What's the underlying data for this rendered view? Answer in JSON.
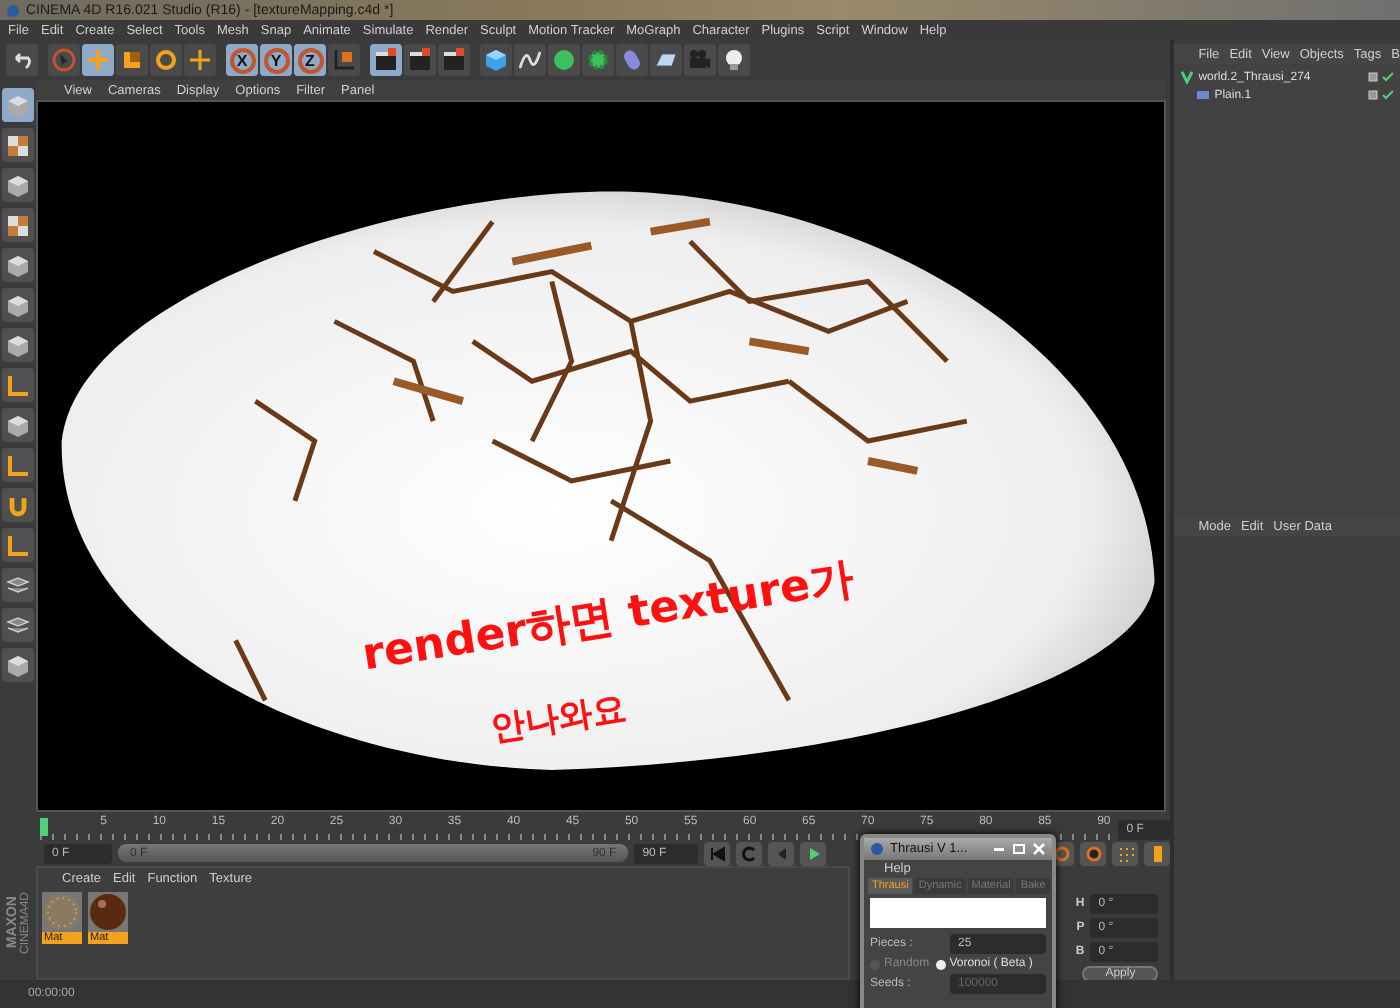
{
  "window": {
    "title": "CINEMA 4D R16.021 Studio (R16) - [textureMapping.c4d *]"
  },
  "menu": [
    "File",
    "Edit",
    "Create",
    "Select",
    "Tools",
    "Mesh",
    "Snap",
    "Animate",
    "Simulate",
    "Render",
    "Sculpt",
    "Motion Tracker",
    "MoGraph",
    "Character",
    "Plugins",
    "Script",
    "Window",
    "Help"
  ],
  "toolbar": [
    {
      "kind": "undo",
      "active": false
    },
    {
      "kind": "select",
      "active": false
    },
    {
      "kind": "move",
      "active": true
    },
    {
      "kind": "scale",
      "active": false
    },
    {
      "kind": "rotate",
      "active": false
    },
    {
      "kind": "crosshair",
      "active": false
    },
    {
      "kind": "axis",
      "label": "X",
      "active": true
    },
    {
      "kind": "axis",
      "label": "Y",
      "active": true
    },
    {
      "kind": "axis",
      "label": "Z",
      "active": true
    },
    {
      "kind": "coord",
      "active": false
    },
    {
      "kind": "clapper",
      "active": true
    },
    {
      "kind": "clapper",
      "active": false
    },
    {
      "kind": "clapper",
      "active": false
    },
    {
      "kind": "cube",
      "active": false
    },
    {
      "kind": "spline",
      "active": false
    },
    {
      "kind": "sphere",
      "active": false
    },
    {
      "kind": "gear",
      "active": false
    },
    {
      "kind": "capsule",
      "active": false
    },
    {
      "kind": "plane",
      "active": false
    },
    {
      "kind": "camera",
      "active": false
    },
    {
      "kind": "bulb",
      "active": false
    }
  ],
  "left_toolbar": [
    {
      "kind": "cube",
      "active": true
    },
    {
      "kind": "checker",
      "active": false
    },
    {
      "kind": "cube",
      "active": false
    },
    {
      "kind": "checker",
      "active": false
    },
    {
      "kind": "cube",
      "active": false
    },
    {
      "kind": "cube",
      "active": false
    },
    {
      "kind": "cube",
      "active": false
    },
    {
      "kind": "orange",
      "active": false
    },
    {
      "kind": "cube",
      "active": false
    },
    {
      "kind": "orange",
      "active": false
    },
    {
      "kind": "magnet",
      "active": false
    },
    {
      "kind": "orange",
      "active": false
    },
    {
      "kind": "layers",
      "active": false
    },
    {
      "kind": "layers",
      "active": false
    },
    {
      "kind": "cube",
      "active": false
    }
  ],
  "viewport": {
    "menu": [
      "View",
      "Cameras",
      "Display",
      "Options",
      "Filter",
      "Panel"
    ],
    "annotation": [
      "render하면 texture가",
      "안나와요"
    ]
  },
  "timeline": {
    "ticks": [
      "5",
      "10",
      "15",
      "20",
      "25",
      "30",
      "35",
      "40",
      "45",
      "50",
      "55",
      "60",
      "65",
      "70",
      "75",
      "80",
      "85",
      "90"
    ],
    "frame_field": "0 F"
  },
  "playback": {
    "start_field": "0 F",
    "range": {
      "start": "0 F",
      "end": "90 F",
      "level": 1
    },
    "end_field": "90 F"
  },
  "materials": {
    "menu": [
      "Create",
      "Edit",
      "Function",
      "Texture"
    ],
    "items": [
      {
        "name": "Mat",
        "kind": "rough"
      },
      {
        "name": "Mat",
        "kind": "glossy"
      }
    ]
  },
  "logo": [
    "MAXON",
    "CINEMA4D"
  ],
  "objects": {
    "menu": [
      "File",
      "Edit",
      "View",
      "Objects",
      "Tags",
      "B"
    ],
    "rows": [
      {
        "name": "world.2_Thrausi_274",
        "kind": "generator",
        "children": [
          {
            "name": "Plain.1",
            "kind": "plane"
          }
        ]
      }
    ]
  },
  "attributes": {
    "menu": [
      "Mode",
      "Edit",
      "User Data"
    ]
  },
  "coordinates": {
    "rows": [
      {
        "axis": "H",
        "value": "0 °"
      },
      {
        "axis": "P",
        "value": "0 °"
      },
      {
        "axis": "B",
        "value": "0 °"
      }
    ],
    "apply": "Apply"
  },
  "dialog": {
    "title": "Thrausi V 1...",
    "menu": [
      "Help"
    ],
    "tabs": [
      {
        "label": "Thrausi",
        "selected": true
      },
      {
        "label": "Dynamic",
        "selected": false
      },
      {
        "label": "Material",
        "selected": false
      },
      {
        "label": "Bake",
        "selected": false
      }
    ],
    "pieces_label": "Pieces :",
    "pieces": "25",
    "modes": [
      {
        "label": "Random",
        "selected": false
      },
      {
        "label": "Voronoi ( Beta )",
        "selected": true
      }
    ],
    "seeds_label": "Seeds :",
    "seeds": "100000"
  },
  "status_bar": {
    "time": "00:00:00"
  }
}
